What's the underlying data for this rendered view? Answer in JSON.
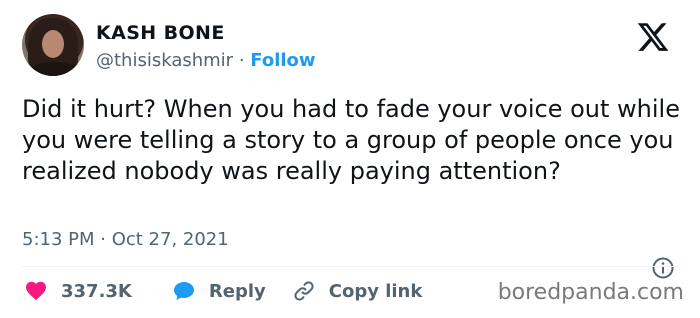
{
  "author": {
    "display_name": "KASH BONE",
    "handle": "@thisiskashmir",
    "separator": " · ",
    "follow_label": "Follow"
  },
  "tweet": {
    "text": "Did it hurt? When you had to fade your voice out while you were telling a story to a group of people once you realized nobody was really paying attention?",
    "timestamp": "5:13 PM · Oct 27, 2021"
  },
  "actions": {
    "like_count": "337.3K",
    "reply_label": "Reply",
    "copy_link_label": "Copy link"
  },
  "watermark": "boredpanda.com",
  "icons": {
    "brand": "x-logo-icon",
    "info": "info-icon",
    "like": "heart-icon",
    "reply": "speech-bubble-icon",
    "copy_link": "link-icon"
  },
  "colors": {
    "accent": "#1d9bf0",
    "like": "#f91880",
    "text": "#0f1419",
    "secondary": "#536471"
  }
}
